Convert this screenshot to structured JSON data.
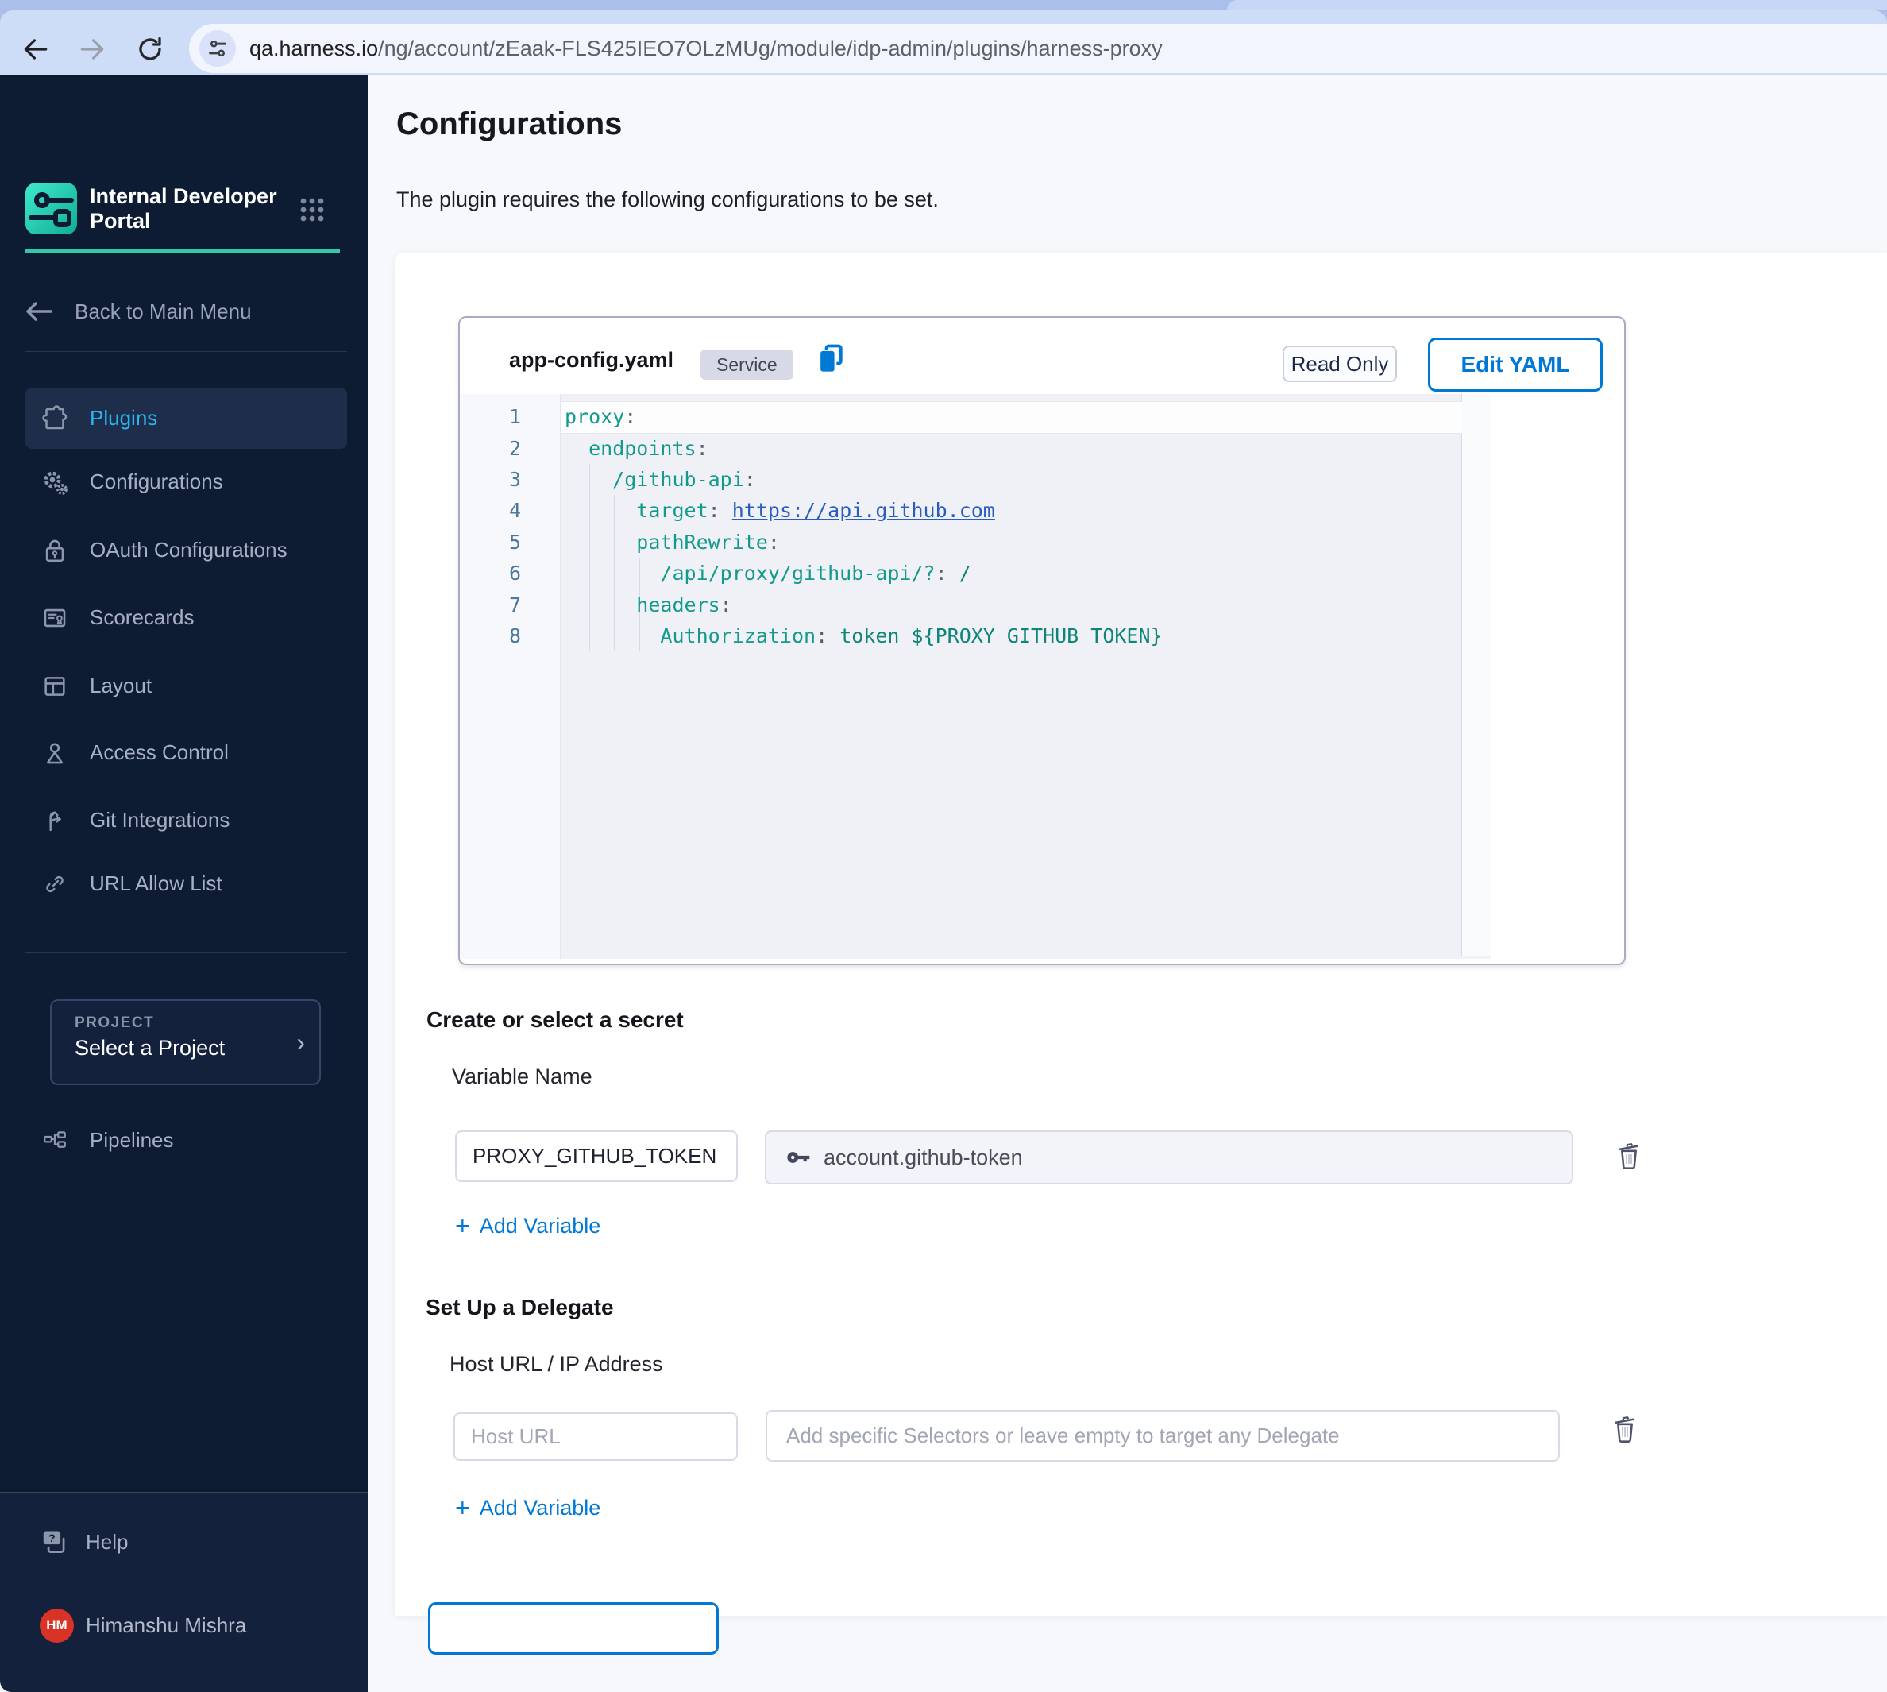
{
  "browser": {
    "url_host": "qa.harness.io",
    "url_path": "/ng/account/zEaak-FLS425IEO7OLzMUg/module/idp-admin/plugins/harness-proxy"
  },
  "sidebar": {
    "brand_line1": "Internal Developer",
    "brand_line2": "Portal",
    "back_label": "Back to Main Menu",
    "nav": [
      {
        "label": "Plugins"
      },
      {
        "label": "Configurations"
      },
      {
        "label": "OAuth Configurations"
      },
      {
        "label": "Scorecards"
      },
      {
        "label": "Layout"
      },
      {
        "label": "Access Control"
      },
      {
        "label": "Git Integrations"
      },
      {
        "label": "URL Allow List"
      }
    ],
    "project_label": "PROJECT",
    "project_value": "Select a Project",
    "project_chevron": "›",
    "pipelines_label": "Pipelines",
    "help_label": "Help",
    "user_initials": "HM",
    "user_name": "Himanshu Mishra"
  },
  "main": {
    "title": "Configurations",
    "subtitle": "The plugin requires the following configurations to be set.",
    "card": {
      "file_name": "app-config.yaml",
      "badge": "Service",
      "read_only": "Read Only",
      "edit_yaml": "Edit YAML"
    },
    "secret": {
      "heading": "Create or select a secret",
      "variable_label": "Variable Name",
      "variable_value": "PROXY_GITHUB_TOKEN",
      "secret_value": "account.github-token",
      "add_plus": "+",
      "add_label": "Add Variable"
    },
    "delegate": {
      "heading": "Set Up a Delegate",
      "host_label": "Host URL / IP Address",
      "host_placeholder": "Host URL",
      "selectors_placeholder": "Add specific Selectors or leave empty to target any Delegate",
      "add_plus": "+",
      "add_label": "Add Variable"
    }
  },
  "editor": {
    "lines": [
      {
        "num": "1",
        "s0": "proxy",
        "s1": ":"
      },
      {
        "num": "2",
        "s0": "  endpoints",
        "s1": ":"
      },
      {
        "num": "3",
        "s0": "    /github-api",
        "s1": ":"
      },
      {
        "num": "4",
        "s0": "      target",
        "s1": ": ",
        "s2": "https://api.github.com"
      },
      {
        "num": "5",
        "s0": "      pathRewrite",
        "s1": ":"
      },
      {
        "num": "6",
        "s0": "        /api/proxy/github-api/?",
        "s1": ": ",
        "s2": "/"
      },
      {
        "num": "7",
        "s0": "      headers",
        "s1": ":"
      },
      {
        "num": "8",
        "s0": "        Authorization",
        "s1": ": ",
        "s2": "token ${PROXY_GITHUB_TOKEN}"
      }
    ]
  },
  "colors": {
    "accent_blue": "#0278d5",
    "teal": "#35c7a9",
    "sidebar_bg": "#0e1c33",
    "active_nav_text": "#2db5f1",
    "avatar_red": "#d93226"
  }
}
